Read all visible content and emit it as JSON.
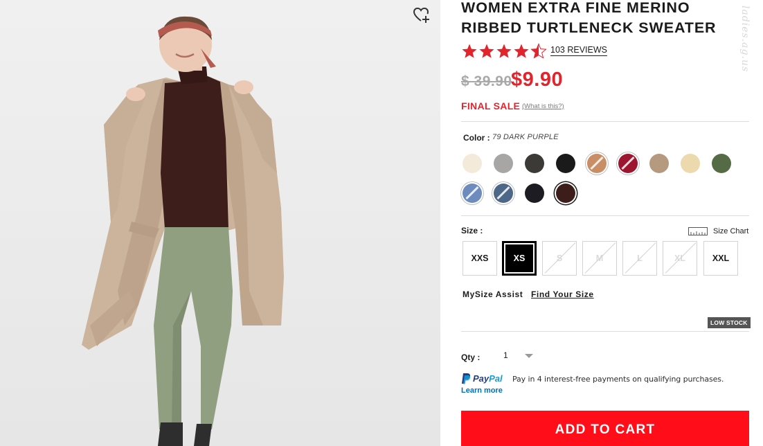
{
  "product": {
    "title": "WOMEN EXTRA FINE MERINO RIBBED TURTLENECK SWEATER",
    "rating": 4.5,
    "reviews_label": "103 REVIEWS",
    "price_original": "$ 39.90",
    "price_sale": "$9.90",
    "final_sale": "FINAL SALE",
    "what_is_this": "(What is this?)",
    "watermark": "ladies.ag.us"
  },
  "color": {
    "label": "Color :",
    "selected_value": "79 DARK PURPLE",
    "swatches": [
      {
        "hex": "#f3ead9",
        "available": true
      },
      {
        "hex": "#a8a6a4",
        "available": true
      },
      {
        "hex": "#3c3a36",
        "available": true
      },
      {
        "hex": "#1a1a1a",
        "available": true
      },
      {
        "hex": "#c98e65",
        "available": false
      },
      {
        "hex": "#9c1630",
        "available": false
      },
      {
        "hex": "#b59a80",
        "available": true
      },
      {
        "hex": "#ecd9ad",
        "available": true
      },
      {
        "hex": "#556b45",
        "available": true
      },
      {
        "hex": "#6d8cbd",
        "available": false
      },
      {
        "hex": "#4d6788",
        "available": false
      },
      {
        "hex": "#1c1c22",
        "available": true
      },
      {
        "hex": "#3d1d1a",
        "available": true,
        "selected": true
      }
    ]
  },
  "size": {
    "label": "Size :",
    "chart_label": "Size Chart",
    "options": [
      {
        "label": "XXS",
        "available": true
      },
      {
        "label": "XS",
        "available": true,
        "selected": true
      },
      {
        "label": "S",
        "available": false
      },
      {
        "label": "M",
        "available": false
      },
      {
        "label": "L",
        "available": false
      },
      {
        "label": "XL",
        "available": false
      },
      {
        "label": "XXL",
        "available": true
      }
    ],
    "mysize_label": "MySize Assist",
    "find_size_label": "Find Your Size",
    "low_stock": "LOW STOCK"
  },
  "quantity": {
    "label": "Qty :",
    "value": "1"
  },
  "paypal": {
    "brand_pay": "Pay",
    "brand_pal": "Pal",
    "description": "Pay in 4 interest-free payments on qualifying purchases.",
    "learn_more": "Learn more"
  },
  "cart": {
    "add_label": "ADD TO CART"
  },
  "colors": {
    "sale_red": "#e2252d",
    "cart_red": "#ff0e1a",
    "paypal_navy": "#253b80",
    "paypal_blue": "#179bd7"
  }
}
